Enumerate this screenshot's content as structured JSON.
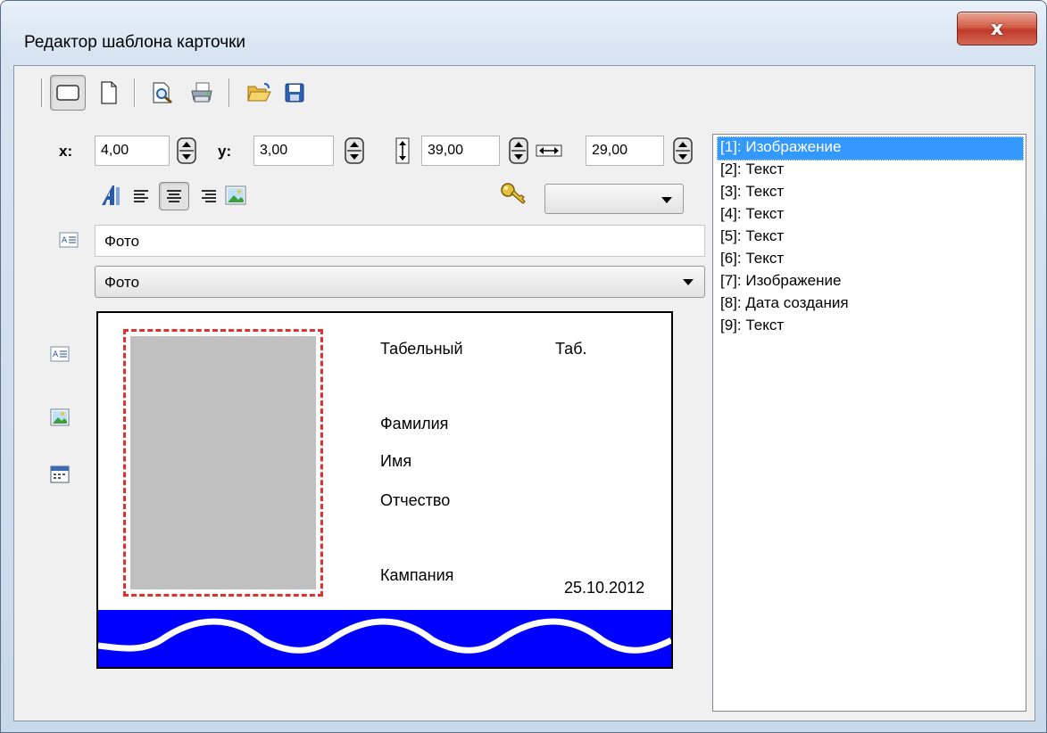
{
  "window": {
    "title": "Редактор шаблона карточки",
    "close_label": "x"
  },
  "toolbar": {
    "buttons": [
      {
        "name": "card-front-icon",
        "active": true
      },
      {
        "name": "card-back-icon",
        "active": false
      },
      {
        "name": "print-preview-icon",
        "active": false
      },
      {
        "name": "print-icon",
        "active": false
      },
      {
        "name": "open-folder-icon",
        "active": false
      },
      {
        "name": "save-icon",
        "active": false
      }
    ]
  },
  "position": {
    "x_label": "x:",
    "x_value": "4,00",
    "y_label": "y:",
    "y_value": "3,00",
    "height_value": "39,00",
    "width_value": "29,00"
  },
  "text_field": {
    "value": "Фото"
  },
  "field_combo": {
    "value": "Фото"
  },
  "key_combo": {
    "value": ""
  },
  "card": {
    "labels": {
      "tab_caption": "Табельный",
      "tab_value": "Таб.",
      "surname": "Фамилия",
      "name": "Имя",
      "patronymic": "Отчество",
      "company": "Кампания",
      "date": "25.10.2012"
    },
    "colors": {
      "band": "#0000ff",
      "photo_frame": "#e23030",
      "photo_fill": "#c0c0c0"
    }
  },
  "elements_list": {
    "items": [
      "[1]: Изображение",
      "[2]: Текст",
      "[3]: Текст",
      "[4]: Текст",
      "[5]: Текст",
      "[6]: Текст",
      "[7]: Изображение",
      "[8]: Дата создания",
      "[9]: Текст"
    ],
    "selected_index": 0
  }
}
